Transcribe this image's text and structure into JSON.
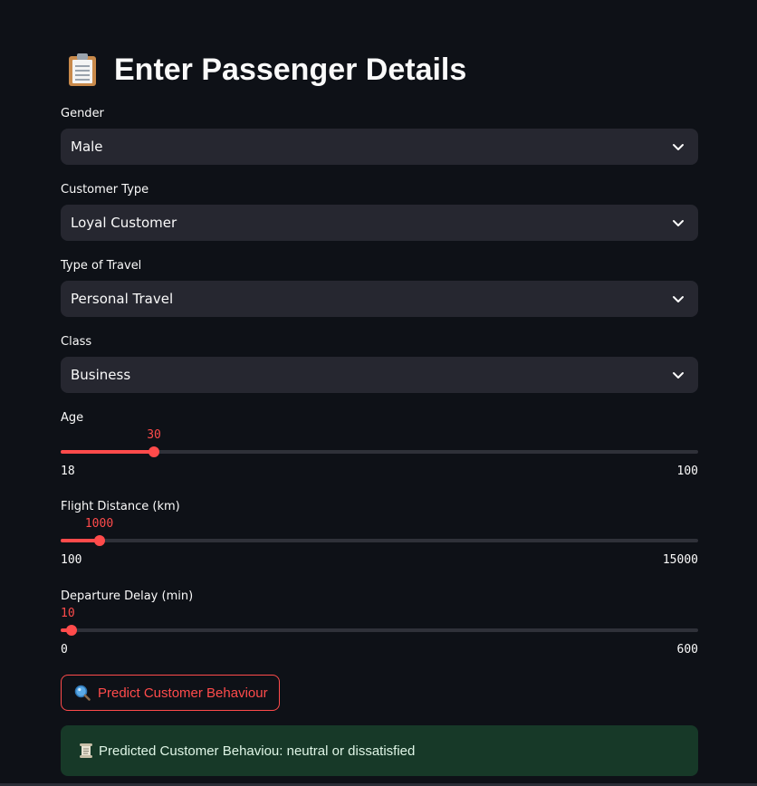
{
  "page": {
    "title": "Enter Passenger Details",
    "title_icon": "clipboard-icon"
  },
  "form": {
    "gender": {
      "label": "Gender",
      "value": "Male"
    },
    "customer_type": {
      "label": "Customer Type",
      "value": "Loyal Customer"
    },
    "travel_type": {
      "label": "Type of Travel",
      "value": "Personal Travel"
    },
    "travel_class": {
      "label": "Class",
      "value": "Business"
    },
    "age": {
      "label": "Age",
      "value": 30,
      "min": 18,
      "max": 100
    },
    "flight_distance": {
      "label": "Flight Distance (km)",
      "value": 1000,
      "min": 100,
      "max": 15000
    },
    "departure_delay": {
      "label": "Departure Delay (min)",
      "value": 10,
      "min": 0,
      "max": 600
    }
  },
  "predict_button": {
    "label": "Predict Customer Behaviour",
    "icon": "magnifier-icon"
  },
  "result": {
    "text": "Predicted Customer Behaviou: neutral or dissatisfied",
    "icon": "scroll-icon"
  },
  "colors": {
    "background": "#0e1117",
    "accent": "#ff4b4b",
    "input_bg": "#262730",
    "success_bg": "#173928"
  }
}
